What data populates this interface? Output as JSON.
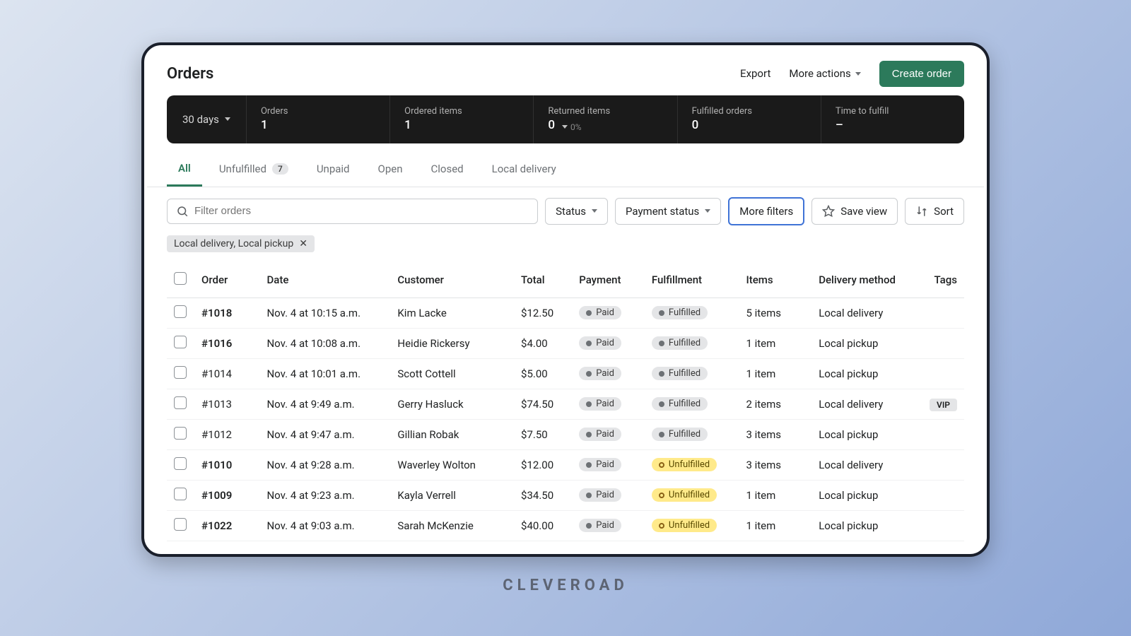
{
  "header": {
    "title": "Orders",
    "export": "Export",
    "more_actions": "More actions",
    "create": "Create order"
  },
  "stats": {
    "period": "30 days",
    "items": [
      {
        "label": "Orders",
        "value": "1"
      },
      {
        "label": "Ordered items",
        "value": "1"
      },
      {
        "label": "Returned items",
        "value": "0",
        "sub": "0%"
      },
      {
        "label": "Fulfilled orders",
        "value": "0"
      },
      {
        "label": "Time to fulfill",
        "value": "–"
      }
    ]
  },
  "tabs": [
    {
      "label": "All",
      "active": true
    },
    {
      "label": "Unfulfilled",
      "count": "7"
    },
    {
      "label": "Unpaid"
    },
    {
      "label": "Open"
    },
    {
      "label": "Closed"
    },
    {
      "label": "Local delivery"
    }
  ],
  "filters": {
    "search_placeholder": "Filter orders",
    "status": "Status",
    "payment_status": "Payment status",
    "more_filters": "More filters",
    "save_view": "Save view",
    "sort": "Sort"
  },
  "chip": "Local delivery, Local pickup",
  "columns": {
    "order": "Order",
    "date": "Date",
    "customer": "Customer",
    "total": "Total",
    "payment": "Payment",
    "fulfillment": "Fulfillment",
    "items": "Items",
    "delivery": "Delivery method",
    "tags": "Tags"
  },
  "rows": [
    {
      "order": "#1018",
      "bold": true,
      "date": "Nov. 4 at 10:15 a.m.",
      "customer": "Kim Lacke",
      "total": "$12.50",
      "payment": "Paid",
      "fulfillment": "Fulfilled",
      "items": "5 items",
      "delivery": "Local delivery",
      "tag": ""
    },
    {
      "order": "#1016",
      "bold": true,
      "date": "Nov. 4 at 10:08 a.m.",
      "customer": "Heidie Rickersy",
      "total": "$4.00",
      "payment": "Paid",
      "fulfillment": "Fulfilled",
      "items": "1 item",
      "delivery": "Local pickup",
      "tag": ""
    },
    {
      "order": "#1014",
      "bold": false,
      "date": "Nov. 4 at 10:01 a.m.",
      "customer": "Scott Cottell",
      "total": "$5.00",
      "payment": "Paid",
      "fulfillment": "Fulfilled",
      "items": "1 item",
      "delivery": "Local pickup",
      "tag": ""
    },
    {
      "order": "#1013",
      "bold": false,
      "date": "Nov. 4 at 9:49 a.m.",
      "customer": "Gerry Hasluck",
      "total": "$74.50",
      "payment": "Paid",
      "fulfillment": "Fulfilled",
      "items": "2 items",
      "delivery": "Local delivery",
      "tag": "VIP"
    },
    {
      "order": "#1012",
      "bold": false,
      "date": "Nov. 4 at 9:47 a.m.",
      "customer": "Gillian Robak",
      "total": "$7.50",
      "payment": "Paid",
      "fulfillment": "Fulfilled",
      "items": "3 items",
      "delivery": "Local pickup",
      "tag": ""
    },
    {
      "order": "#1010",
      "bold": true,
      "date": "Nov. 4 at 9:28 a.m.",
      "customer": "Waverley Wolton",
      "total": "$12.00",
      "payment": "Paid",
      "fulfillment": "Unfulfilled",
      "items": "3 items",
      "delivery": "Local delivery",
      "tag": ""
    },
    {
      "order": "#1009",
      "bold": true,
      "date": "Nov. 4 at 9:23 a.m.",
      "customer": "Kayla Verrell",
      "total": "$34.50",
      "payment": "Paid",
      "fulfillment": "Unfulfilled",
      "items": "1 item",
      "delivery": "Local pickup",
      "tag": ""
    },
    {
      "order": "#1022",
      "bold": true,
      "date": "Nov. 4 at 9:03 a.m.",
      "customer": "Sarah McKenzie",
      "total": "$40.00",
      "payment": "Paid",
      "fulfillment": "Unfulfilled",
      "items": "1 item",
      "delivery": "Local pickup",
      "tag": ""
    }
  ],
  "brand": "CLEVEROAD"
}
